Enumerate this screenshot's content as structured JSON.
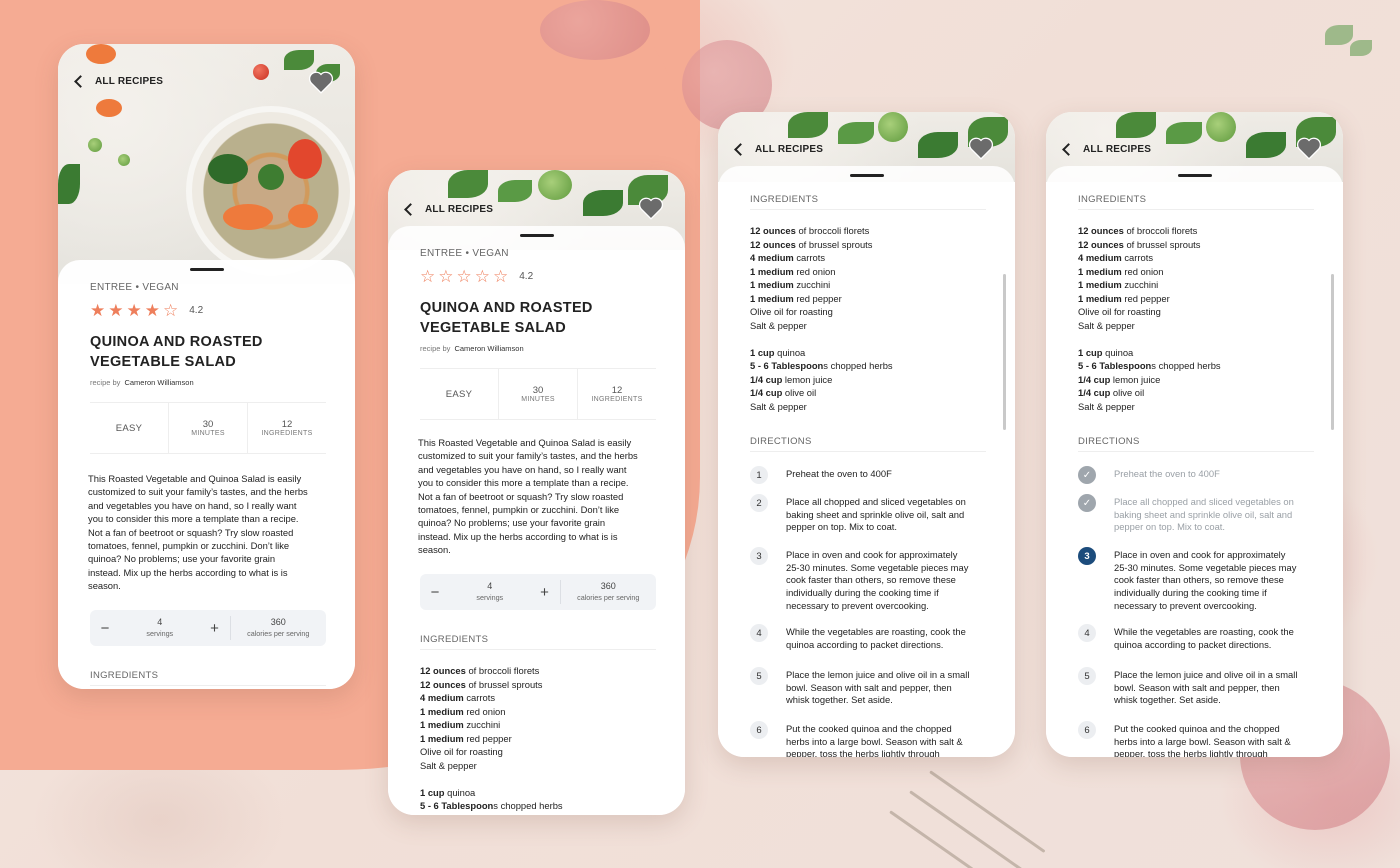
{
  "colors": {
    "accent_blob": "#f5ab93",
    "star": "#ee7f5c",
    "active_step": "#1c4c7c",
    "done_step": "#9fa6ad"
  },
  "nav": {
    "back_label": "ALL RECIPES"
  },
  "recipe": {
    "category": "ENTREE  •  VEGAN",
    "rating": "4.2",
    "rating_value": 4.2,
    "title_line1": "QUINOA AND ROASTED",
    "title_line2": "VEGETABLE SALAD",
    "recipe_by_label": "recipe by",
    "author": "Cameron Williamson",
    "difficulty": "EASY",
    "time_value": "30",
    "time_label": "MINUTES",
    "ingredients_count": "12",
    "ingredients_count_label": "INGREDIENTS",
    "description": [
      "This Roasted Vegetable and Quinoa Salad is easily",
      "customized to suit your family’s tastes, and the herbs",
      "and vegetables you have on hand, so I really want",
      "you to consider this more a template than a recipe.",
      "Not a fan of beetroot or squash?  Try slow roasted",
      "tomatoes, fennel, pumpkin or zucchini.  Don’t like",
      "quinoa? No problems; use your favorite grain",
      "instead.  Mix up the herbs according to what is is",
      "season."
    ],
    "servings_minus": "−",
    "servings_plus": "+",
    "servings_value": "4",
    "servings_label": "servings",
    "calories_value": "360",
    "calories_label": "calories per serving",
    "ingredients_header": "INGREDIENTS",
    "directions_header": "DIRECTIONS",
    "ingredients": [
      {
        "qty": "12 ounces",
        "item": " of broccoli florets"
      },
      {
        "qty": "12 ounces",
        "item": " of brussel sprouts"
      },
      {
        "qty": "4 medium",
        "item": " carrots"
      },
      {
        "qty": "1 medium",
        "item": " red onion"
      },
      {
        "qty": "1 medium",
        "item": " zucchini"
      },
      {
        "qty": "1 medium",
        "item": " red pepper"
      },
      {
        "qty": "",
        "item": "Olive oil for roasting"
      },
      {
        "qty": "",
        "item": "Salt & pepper"
      },
      {
        "qty": "",
        "item": ""
      },
      {
        "qty": "1 cup",
        "item": " quinoa"
      },
      {
        "qty": "5 - 6 Tablespoon",
        "item": "s chopped herbs"
      },
      {
        "qty": "1/4 cup",
        "item": " lemon juice"
      },
      {
        "qty": "1/4 cup",
        "item": " olive oil"
      },
      {
        "qty": "",
        "item": "Salt & pepper"
      }
    ],
    "directions": [
      {
        "n": "1",
        "lines": [
          "Preheat the oven to 400F"
        ]
      },
      {
        "n": "2",
        "lines": [
          "Place all chopped and sliced vegetables on",
          "baking sheet and sprinkle olive oil, salt and",
          "pepper on top. Mix to coat."
        ]
      },
      {
        "n": "3",
        "lines": [
          "Place in oven and cook for approximately",
          "25-30 minutes. Some vegetable pieces may",
          "cook faster than others, so remove these",
          "individually during the cooking time if",
          "necessary to prevent overcooking."
        ]
      },
      {
        "n": "4",
        "lines": [
          "While the vegetables are roasting, cook the",
          "quinoa according to packet directions."
        ]
      },
      {
        "n": "5",
        "lines": [
          "Place the lemon juice and olive oil in a small",
          "bowl. Season with salt and pepper, then",
          "whisk together. Set aside."
        ]
      },
      {
        "n": "6",
        "lines": [
          "Put the cooked quinoa and the chopped",
          "herbs into a large bowl. Season with salt &",
          "pepper, toss the herbs lightly through"
        ]
      }
    ]
  }
}
